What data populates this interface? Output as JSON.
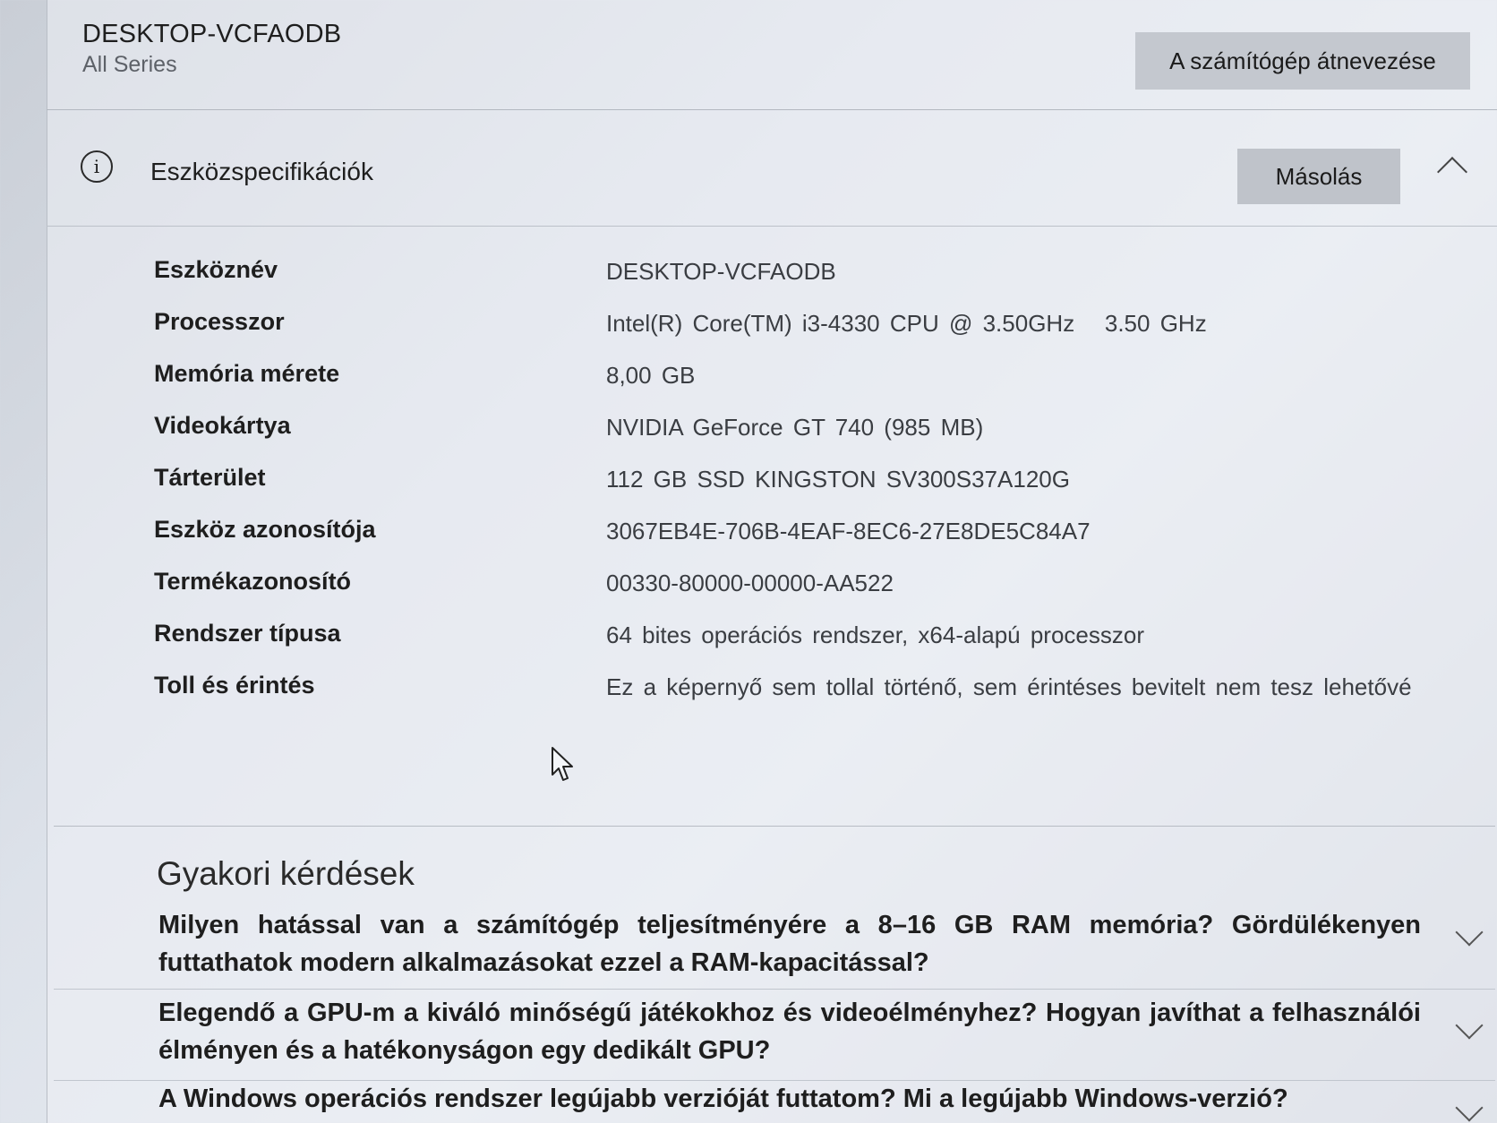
{
  "computer": {
    "name": "DESKTOP-VCFAODB",
    "series": "All Series",
    "rename_label": "A számítógép átnevezése"
  },
  "specs": {
    "title": "Eszközspecifikációk",
    "icon": "info-icon",
    "copy_label": "Másolás",
    "rows": [
      {
        "label": "Eszköznév",
        "value": "DESKTOP-VCFAODB"
      },
      {
        "label": "Processzor",
        "value": "Intel(R) Core(TM) i3-4330 CPU @ 3.50GHz   3.50 GHz"
      },
      {
        "label": "Memória mérete",
        "value": "8,00 GB"
      },
      {
        "label": "Videokártya",
        "value": "NVIDIA GeForce GT 740 (985 MB)"
      },
      {
        "label": "Tárterület",
        "value": "112 GB SSD KINGSTON SV300S37A120G"
      },
      {
        "label": "Eszköz azonosítója",
        "value": "3067EB4E-706B-4EAF-8EC6-27E8DE5C84A7"
      },
      {
        "label": "Termékazonosító",
        "value": "00330-80000-00000-AA522"
      },
      {
        "label": "Rendszer típusa",
        "value": "64 bites operációs rendszer, x64-alapú processzor"
      },
      {
        "label": "Toll és érintés",
        "value": "Ez a képernyő sem tollal történő, sem érintéses bevitelt nem tesz lehetővé"
      }
    ]
  },
  "faq": {
    "title": "Gyakori kérdések",
    "items": [
      {
        "question": "Milyen hatással van a számítógép teljesítményére a 8–16 GB RAM memória? Gördülékenyen futtathatok modern alkalmazásokat ezzel a RAM-kapacitással?"
      },
      {
        "question": "Elegendő a GPU-m a kiváló minőségű játékokhoz és videoélményhez? Hogyan javíthat a felhasználói élményen és a hatékonyságon egy dedikált GPU?"
      },
      {
        "question": "A Windows operációs rendszer legújabb verzióját futtatom? Mi a legújabb Windows-verzió?"
      }
    ]
  }
}
